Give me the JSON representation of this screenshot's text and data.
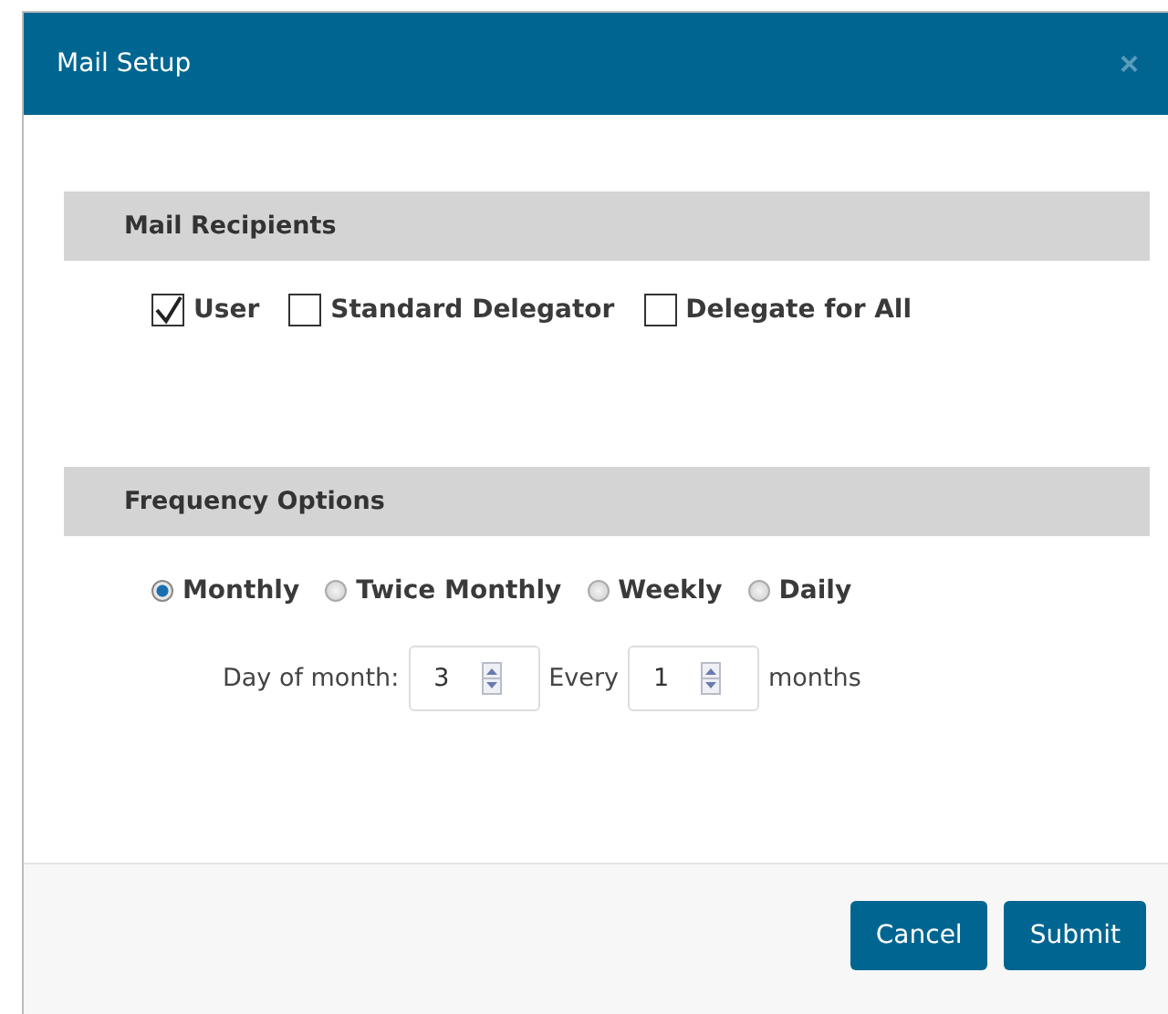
{
  "dialog": {
    "title": "Mail Setup",
    "close": "×"
  },
  "sections": [
    {
      "title": "Mail Recipients",
      "kind": "checkboxes",
      "options": [
        {
          "label": "User",
          "checked": true
        },
        {
          "label": "Standard Delegator",
          "checked": false
        },
        {
          "label": "Delegate for All",
          "checked": false
        }
      ]
    },
    {
      "title": "Frequency Options",
      "kind": "radios",
      "options": [
        {
          "label": "Monthly",
          "selected": true
        },
        {
          "label": "Twice Monthly",
          "selected": false
        },
        {
          "label": "Weekly",
          "selected": false
        },
        {
          "label": "Daily",
          "selected": false
        }
      ]
    }
  ],
  "schedule": {
    "day_label": "Day of month:",
    "day_value": "3",
    "every_label": "Every",
    "every_value": "1",
    "unit": "months"
  },
  "buttons": [
    "Cancel",
    "Submit"
  ]
}
